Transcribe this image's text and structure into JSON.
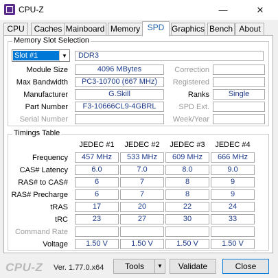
{
  "window": {
    "title": "CPU-Z",
    "min_glyph": "—",
    "close_glyph": "✕"
  },
  "tabs": [
    "CPU",
    "Caches",
    "Mainboard",
    "Memory",
    "SPD",
    "Graphics",
    "Bench",
    "About"
  ],
  "active_tab": "SPD",
  "slot": {
    "group_title": "Memory Slot Selection",
    "selected": "Slot #1",
    "type": "DDR3",
    "module_size_label": "Module Size",
    "module_size": "4096 MBytes",
    "max_bandwidth_label": "Max Bandwidth",
    "max_bandwidth": "PC3-10700 (667 MHz)",
    "manufacturer_label": "Manufacturer",
    "manufacturer": "G.Skill",
    "part_number_label": "Part Number",
    "part_number": "F3-10666CL9-4GBRL",
    "serial_number_label": "Serial Number",
    "serial_number": "",
    "correction_label": "Correction",
    "correction": "",
    "registered_label": "Registered",
    "registered": "",
    "ranks_label": "Ranks",
    "ranks": "Single",
    "spd_ext_label": "SPD Ext.",
    "spd_ext": "",
    "week_year_label": "Week/Year",
    "week_year": ""
  },
  "timings": {
    "group_title": "Timings Table",
    "columns": [
      "JEDEC #1",
      "JEDEC #2",
      "JEDEC #3",
      "JEDEC #4"
    ],
    "rows": [
      {
        "label": "Frequency",
        "values": [
          "457 MHz",
          "533 MHz",
          "609 MHz",
          "666 MHz"
        ]
      },
      {
        "label": "CAS# Latency",
        "values": [
          "6.0",
          "7.0",
          "8.0",
          "9.0"
        ]
      },
      {
        "label": "RAS# to CAS#",
        "values": [
          "6",
          "7",
          "8",
          "9"
        ]
      },
      {
        "label": "RAS# Precharge",
        "values": [
          "6",
          "7",
          "8",
          "9"
        ]
      },
      {
        "label": "tRAS",
        "values": [
          "17",
          "20",
          "22",
          "24"
        ]
      },
      {
        "label": "tRC",
        "values": [
          "23",
          "27",
          "30",
          "33"
        ]
      },
      {
        "label": "Command Rate",
        "values": [
          "",
          "",
          "",
          ""
        ]
      },
      {
        "label": "Voltage",
        "values": [
          "1.50 V",
          "1.50 V",
          "1.50 V",
          "1.50 V"
        ]
      }
    ]
  },
  "footer": {
    "brand": "CPU-Z",
    "version": "Ver. 1.77.0.x64",
    "tools_label": "Tools",
    "validate_label": "Validate",
    "close_label": "Close"
  },
  "colors": {
    "accent": "#0078d7",
    "value_text": "#1c3a8a",
    "active_tab_text": "#1c5fb0",
    "app_icon": "#5a2b8c"
  }
}
